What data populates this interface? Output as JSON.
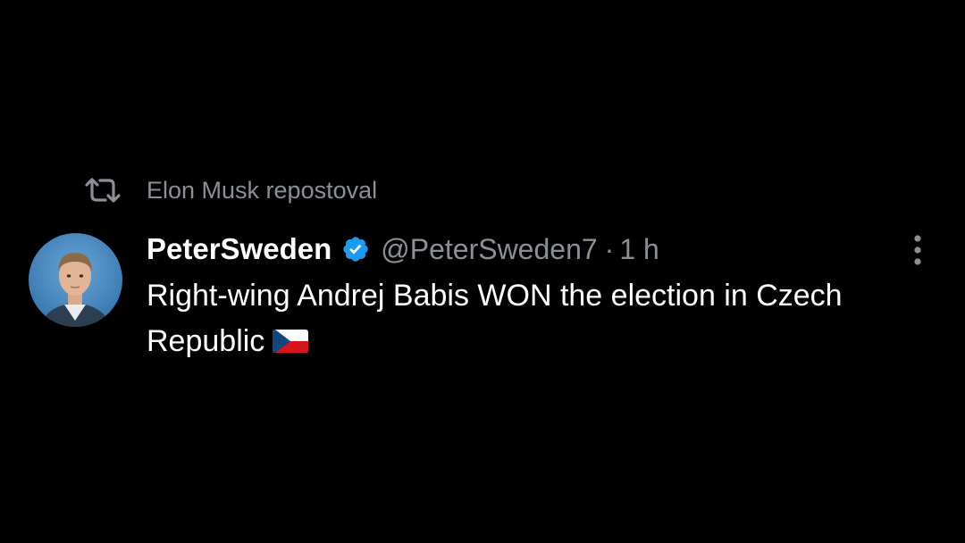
{
  "repost": {
    "icon": "repost-icon",
    "label": "Elon Musk repostoval"
  },
  "author": {
    "avatar": "avatar",
    "display_name": "PeterSweden",
    "verified_icon": "verified-badge-icon",
    "handle": "@PeterSweden7",
    "separator": "·",
    "time": "1 h"
  },
  "post": {
    "text": "Right-wing Andrej Babis WON the election in Czech Republic",
    "emoji": "czech-flag-emoji"
  },
  "more_icon": "more-vertical-icon",
  "colors": {
    "background": "#000000",
    "primary_text": "#ffffff",
    "secondary_text": "#8b9097",
    "verified_blue": "#1d9bf0"
  }
}
